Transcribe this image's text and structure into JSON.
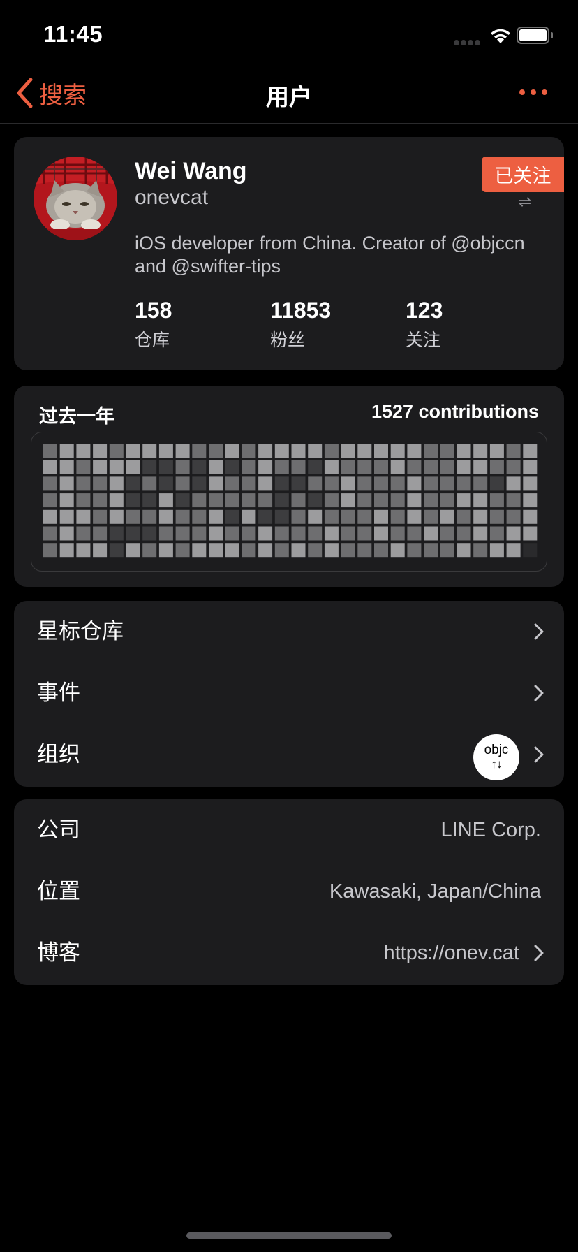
{
  "status_bar": {
    "time": "11:45"
  },
  "nav": {
    "back_label": "搜索",
    "title": "用户"
  },
  "profile": {
    "name": "Wei Wang",
    "login": "onevcat",
    "follow_label": "已关注",
    "bio": "iOS developer from China. Creator of @objccn and @swifter-tips",
    "stats": [
      {
        "value": "158",
        "label": "仓库"
      },
      {
        "value": "11853",
        "label": "粉丝"
      },
      {
        "value": "123",
        "label": "关注"
      }
    ]
  },
  "contributions": {
    "title": "过去一年",
    "count_label": "1527 contributions",
    "levels": [
      [
        2,
        3,
        3,
        3,
        2,
        3,
        3,
        3,
        3,
        2,
        2,
        3,
        2,
        3,
        3,
        3,
        3,
        2,
        3,
        3,
        3,
        3,
        3,
        2,
        2,
        3,
        3,
        3,
        2,
        3
      ],
      [
        3,
        3,
        2,
        3,
        3,
        3,
        1,
        1,
        2,
        1,
        3,
        1,
        2,
        3,
        2,
        2,
        1,
        3,
        2,
        2,
        2,
        3,
        2,
        2,
        2,
        3,
        3,
        2,
        2,
        3
      ],
      [
        2,
        3,
        2,
        2,
        3,
        1,
        2,
        1,
        2,
        1,
        3,
        2,
        2,
        3,
        1,
        1,
        2,
        2,
        3,
        2,
        2,
        2,
        3,
        2,
        2,
        2,
        2,
        1,
        3,
        3
      ],
      [
        2,
        3,
        2,
        2,
        3,
        1,
        1,
        3,
        1,
        2,
        2,
        2,
        2,
        2,
        1,
        2,
        1,
        2,
        3,
        2,
        2,
        2,
        3,
        2,
        2,
        3,
        3,
        2,
        2,
        3
      ],
      [
        3,
        3,
        3,
        2,
        3,
        2,
        2,
        3,
        2,
        2,
        3,
        1,
        3,
        1,
        1,
        2,
        3,
        2,
        2,
        2,
        3,
        2,
        3,
        2,
        3,
        2,
        3,
        2,
        2,
        3
      ],
      [
        2,
        3,
        2,
        2,
        1,
        1,
        1,
        2,
        2,
        2,
        3,
        2,
        2,
        3,
        2,
        2,
        2,
        3,
        2,
        2,
        3,
        2,
        2,
        3,
        2,
        2,
        3,
        2,
        3,
        3
      ],
      [
        2,
        3,
        3,
        3,
        1,
        3,
        2,
        3,
        2,
        3,
        3,
        3,
        2,
        3,
        2,
        3,
        2,
        3,
        2,
        2,
        2,
        3,
        2,
        2,
        2,
        3,
        2,
        3,
        3,
        0
      ]
    ],
    "level_colors": [
      "#2a2a2c",
      "#3d3d3f",
      "#6e6e70",
      "#9c9c9e"
    ]
  },
  "nav_rows": [
    {
      "label": "星标仓库"
    },
    {
      "label": "事件"
    },
    {
      "label": "组织",
      "org_name": "objc",
      "org_arrows": "↑↓"
    }
  ],
  "info_rows": [
    {
      "label": "公司",
      "value": "LINE Corp."
    },
    {
      "label": "位置",
      "value": "Kawasaki, Japan/China"
    },
    {
      "label": "博客",
      "value": "https://onev.cat"
    }
  ],
  "colors": {
    "accent": "#ed5f41",
    "card": "#1c1c1e",
    "background": "#000000"
  },
  "icons": [
    "back-chevron-icon",
    "more-icon",
    "swap-icon",
    "chevron-right-icon",
    "wifi-icon",
    "battery-icon",
    "signal-icon"
  ]
}
